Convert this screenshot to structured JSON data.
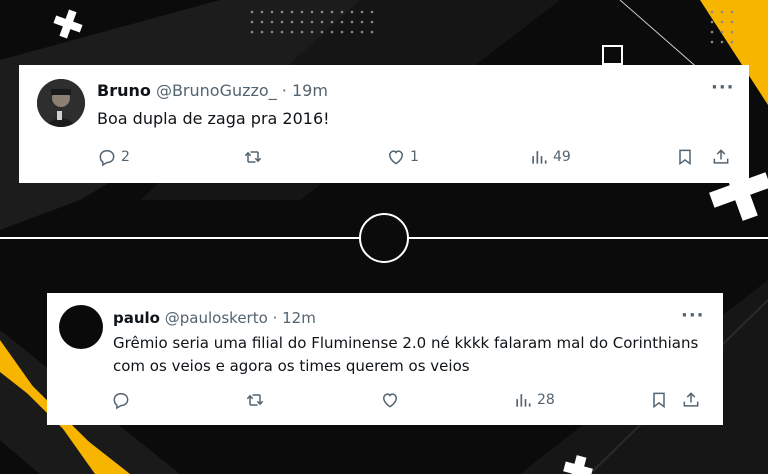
{
  "tweets": [
    {
      "name": "Bruno",
      "handle": "@BrunoGuzzo_",
      "separator": "·",
      "time": "19m",
      "text": "Boa dupla de zaga pra 2016!",
      "replies": "2",
      "retweets": "",
      "likes": "1",
      "views": "49"
    },
    {
      "name": "paulo",
      "handle": "@pauloskerto",
      "separator": "·",
      "time": "12m",
      "text": "Grêmio seria uma filial do Fluminense 2.0 né kkkk falaram mal do Corinthians com os veios e agora os times querem os veios",
      "replies": "",
      "retweets": "",
      "likes": "",
      "views": "28"
    }
  ],
  "more_label": "···",
  "icons": [
    "reply-icon",
    "retweet-icon",
    "like-icon",
    "views-icon",
    "bookmark-icon",
    "share-icon",
    "more-icon"
  ],
  "colors": {
    "background": "#0b0b0b",
    "accent": "#f7b500",
    "card": "#ffffff",
    "muted": "#536471"
  }
}
